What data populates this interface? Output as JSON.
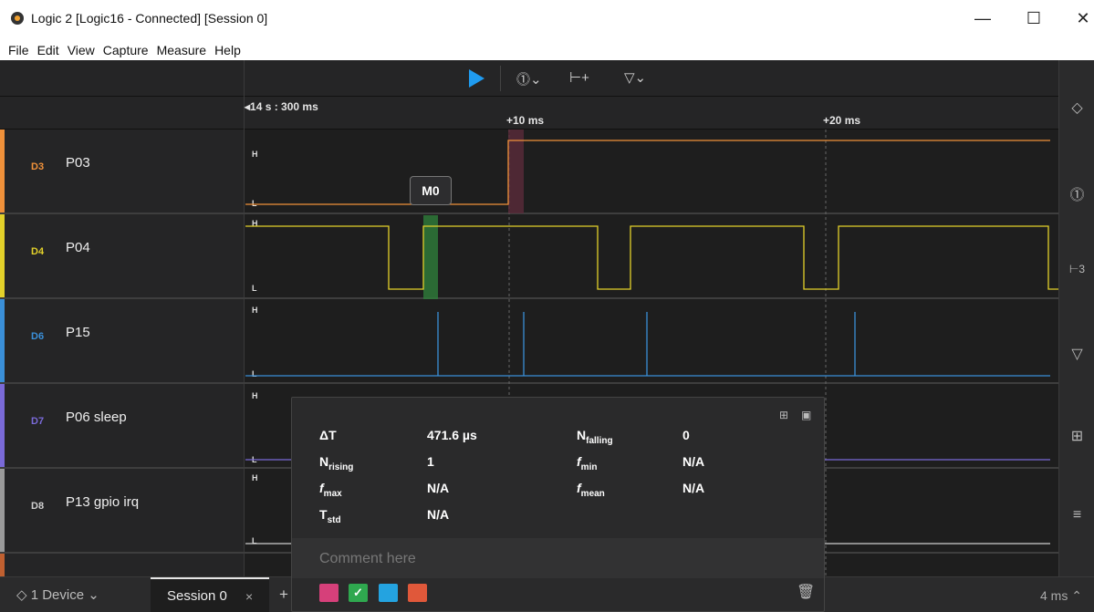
{
  "window": {
    "title": "Logic 2 [Logic16 - Connected] [Session 0]",
    "minimize": "—",
    "maximize": "☐",
    "close": "✕"
  },
  "menu": [
    "File",
    "Edit",
    "View",
    "Capture",
    "Measure",
    "Help"
  ],
  "toolbar": {
    "trigger_icon": "trigger-icon",
    "measure_icon": "measure-icon",
    "marker_icon": "marker-icon"
  },
  "timeline": {
    "start": "14 s : 300 ms",
    "tick1": "+10 ms",
    "tick2": "+20 ms"
  },
  "channels": [
    {
      "id": "D3",
      "name": "P03",
      "color": "#f0913a"
    },
    {
      "id": "D4",
      "name": "P04",
      "color": "#e3d12a"
    },
    {
      "id": "D6",
      "name": "P15",
      "color": "#3a8fd8"
    },
    {
      "id": "D7",
      "name": "P06 sleep",
      "color": "#7a6ad8"
    },
    {
      "id": "D8",
      "name": "P13 gpio irq",
      "color": "#cfcfcf"
    }
  ],
  "levels": {
    "high": "H",
    "low": "L"
  },
  "marker": {
    "label": "M0"
  },
  "measurement": {
    "dt_label": "ΔT",
    "dt_value": "471.6 µs",
    "nrising_label": "N",
    "nrising_sub": "rising",
    "nrising_value": "1",
    "fmax_label": "f",
    "fmax_sub": "max",
    "fmax_value": "N/A",
    "tstd_label": "T",
    "tstd_sub": "std",
    "tstd_value": "N/A",
    "nfalling_label": "N",
    "nfalling_sub": "falling",
    "nfalling_value": "0",
    "fmin_label": "f",
    "fmin_sub": "min",
    "fmin_value": "N/A",
    "fmean_label": "f",
    "fmean_sub": "mean",
    "fmean_value": "N/A",
    "comment_placeholder": "Comment here",
    "swatches": [
      "#d6407a",
      "#2fa84f",
      "#24a3e0",
      "#e0583a"
    ]
  },
  "bottom": {
    "device": "1 Device",
    "session": "Session 0",
    "session_close": "×",
    "add": "+",
    "zoom": "4 ms"
  }
}
